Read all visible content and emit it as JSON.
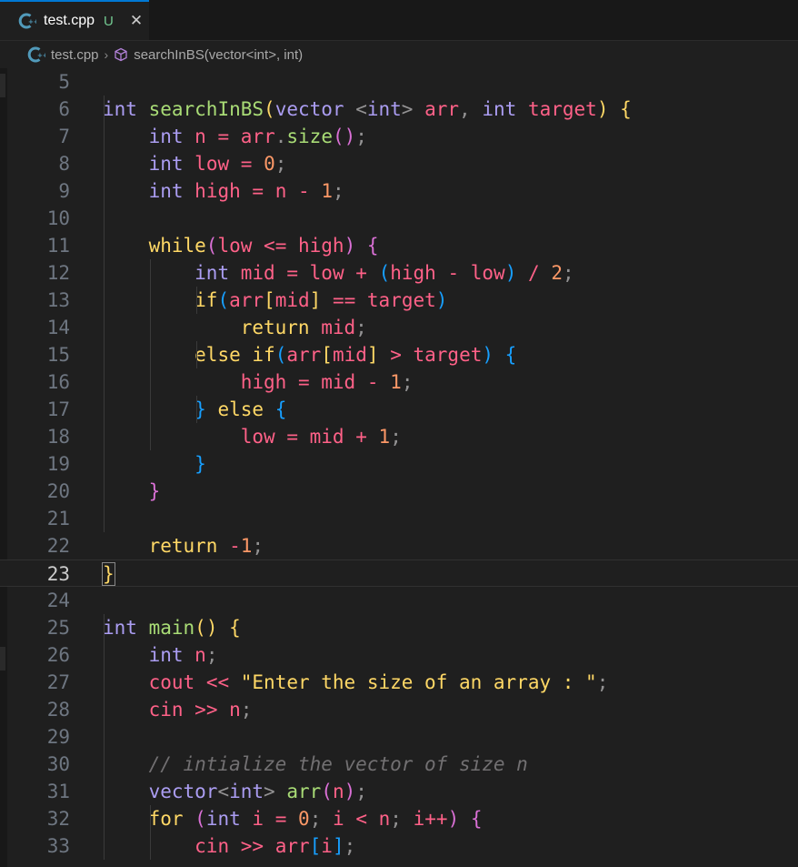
{
  "tab": {
    "filename": "test.cpp",
    "status": "U",
    "close": "✕"
  },
  "breadcrumb": {
    "file": "test.cpp",
    "separator": "›",
    "symbol": "searchInBS(vector<int>, int)"
  },
  "icons": {
    "cpp": "cpp-file-icon",
    "symbol": "cube-symbol-icon",
    "close": "close-icon"
  },
  "colors": {
    "background": "#1f1f1f",
    "tab_accent": "#0078d4",
    "keyword": "#ab9df2",
    "function": "#a9dc76",
    "variable": "#ff6188",
    "number": "#fc9867",
    "string": "#ffd866",
    "comment": "#727072",
    "untracked": "#73c991"
  },
  "editor": {
    "current_line": 23,
    "lines": [
      {
        "n": "5",
        "tokens": []
      },
      {
        "n": "6",
        "tokens": [
          [
            "kw",
            "int"
          ],
          [
            "pl",
            " "
          ],
          [
            "fn",
            "searchInBS"
          ],
          [
            "b1",
            "("
          ],
          [
            "kw",
            "vector"
          ],
          [
            "pl",
            " "
          ],
          [
            "punc",
            "<"
          ],
          [
            "kw",
            "int"
          ],
          [
            "punc",
            ">"
          ],
          [
            "pl",
            " "
          ],
          [
            "var",
            "arr"
          ],
          [
            "punc",
            ","
          ],
          [
            "pl",
            " "
          ],
          [
            "kw",
            "int"
          ],
          [
            "pl",
            " "
          ],
          [
            "var",
            "target"
          ],
          [
            "b1",
            ")"
          ],
          [
            "pl",
            " "
          ],
          [
            "b1",
            "{"
          ]
        ]
      },
      {
        "n": "7",
        "tokens": [
          [
            "pl",
            "    "
          ],
          [
            "kw",
            "int"
          ],
          [
            "pl",
            " "
          ],
          [
            "var",
            "n"
          ],
          [
            "pl",
            " "
          ],
          [
            "op",
            "="
          ],
          [
            "pl",
            " "
          ],
          [
            "var",
            "arr"
          ],
          [
            "punc",
            "."
          ],
          [
            "fn",
            "size"
          ],
          [
            "b2",
            "()"
          ],
          [
            "punc",
            ";"
          ]
        ]
      },
      {
        "n": "8",
        "tokens": [
          [
            "pl",
            "    "
          ],
          [
            "kw",
            "int"
          ],
          [
            "pl",
            " "
          ],
          [
            "var",
            "low"
          ],
          [
            "pl",
            " "
          ],
          [
            "op",
            "="
          ],
          [
            "pl",
            " "
          ],
          [
            "num",
            "0"
          ],
          [
            "punc",
            ";"
          ]
        ]
      },
      {
        "n": "9",
        "tokens": [
          [
            "pl",
            "    "
          ],
          [
            "kw",
            "int"
          ],
          [
            "pl",
            " "
          ],
          [
            "var",
            "high"
          ],
          [
            "pl",
            " "
          ],
          [
            "op",
            "="
          ],
          [
            "pl",
            " "
          ],
          [
            "var",
            "n"
          ],
          [
            "pl",
            " "
          ],
          [
            "op",
            "-"
          ],
          [
            "pl",
            " "
          ],
          [
            "num",
            "1"
          ],
          [
            "punc",
            ";"
          ]
        ]
      },
      {
        "n": "10",
        "tokens": []
      },
      {
        "n": "11",
        "tokens": [
          [
            "pl",
            "    "
          ],
          [
            "ctl",
            "while"
          ],
          [
            "b2",
            "("
          ],
          [
            "var",
            "low"
          ],
          [
            "pl",
            " "
          ],
          [
            "op",
            "<="
          ],
          [
            "pl",
            " "
          ],
          [
            "var",
            "high"
          ],
          [
            "b2",
            ")"
          ],
          [
            "pl",
            " "
          ],
          [
            "b2",
            "{"
          ]
        ]
      },
      {
        "n": "12",
        "tokens": [
          [
            "pl",
            "        "
          ],
          [
            "kw",
            "int"
          ],
          [
            "pl",
            " "
          ],
          [
            "var",
            "mid"
          ],
          [
            "pl",
            " "
          ],
          [
            "op",
            "="
          ],
          [
            "pl",
            " "
          ],
          [
            "var",
            "low"
          ],
          [
            "pl",
            " "
          ],
          [
            "op",
            "+"
          ],
          [
            "pl",
            " "
          ],
          [
            "b3",
            "("
          ],
          [
            "var",
            "high"
          ],
          [
            "pl",
            " "
          ],
          [
            "op",
            "-"
          ],
          [
            "pl",
            " "
          ],
          [
            "var",
            "low"
          ],
          [
            "b3",
            ")"
          ],
          [
            "pl",
            " "
          ],
          [
            "op",
            "/"
          ],
          [
            "pl",
            " "
          ],
          [
            "num",
            "2"
          ],
          [
            "punc",
            ";"
          ]
        ]
      },
      {
        "n": "13",
        "tokens": [
          [
            "pl",
            "        "
          ],
          [
            "ctl",
            "if"
          ],
          [
            "b3",
            "("
          ],
          [
            "var",
            "arr"
          ],
          [
            "b1",
            "["
          ],
          [
            "var",
            "mid"
          ],
          [
            "b1",
            "]"
          ],
          [
            "pl",
            " "
          ],
          [
            "op",
            "=="
          ],
          [
            "pl",
            " "
          ],
          [
            "var",
            "target"
          ],
          [
            "b3",
            ")"
          ]
        ]
      },
      {
        "n": "14",
        "tokens": [
          [
            "pl",
            "            "
          ],
          [
            "ctl",
            "return"
          ],
          [
            "pl",
            " "
          ],
          [
            "var",
            "mid"
          ],
          [
            "punc",
            ";"
          ]
        ]
      },
      {
        "n": "15",
        "tokens": [
          [
            "pl",
            "        "
          ],
          [
            "ctl",
            "else"
          ],
          [
            "pl",
            " "
          ],
          [
            "ctl",
            "if"
          ],
          [
            "b3",
            "("
          ],
          [
            "var",
            "arr"
          ],
          [
            "b1",
            "["
          ],
          [
            "var",
            "mid"
          ],
          [
            "b1",
            "]"
          ],
          [
            "pl",
            " "
          ],
          [
            "op",
            ">"
          ],
          [
            "pl",
            " "
          ],
          [
            "var",
            "target"
          ],
          [
            "b3",
            ")"
          ],
          [
            "pl",
            " "
          ],
          [
            "b3",
            "{"
          ]
        ]
      },
      {
        "n": "16",
        "tokens": [
          [
            "pl",
            "            "
          ],
          [
            "var",
            "high"
          ],
          [
            "pl",
            " "
          ],
          [
            "op",
            "="
          ],
          [
            "pl",
            " "
          ],
          [
            "var",
            "mid"
          ],
          [
            "pl",
            " "
          ],
          [
            "op",
            "-"
          ],
          [
            "pl",
            " "
          ],
          [
            "num",
            "1"
          ],
          [
            "punc",
            ";"
          ]
        ]
      },
      {
        "n": "17",
        "tokens": [
          [
            "pl",
            "        "
          ],
          [
            "b3",
            "}"
          ],
          [
            "pl",
            " "
          ],
          [
            "ctl",
            "else"
          ],
          [
            "pl",
            " "
          ],
          [
            "b3",
            "{"
          ]
        ]
      },
      {
        "n": "18",
        "tokens": [
          [
            "pl",
            "            "
          ],
          [
            "var",
            "low"
          ],
          [
            "pl",
            " "
          ],
          [
            "op",
            "="
          ],
          [
            "pl",
            " "
          ],
          [
            "var",
            "mid"
          ],
          [
            "pl",
            " "
          ],
          [
            "op",
            "+"
          ],
          [
            "pl",
            " "
          ],
          [
            "num",
            "1"
          ],
          [
            "punc",
            ";"
          ]
        ]
      },
      {
        "n": "19",
        "tokens": [
          [
            "pl",
            "        "
          ],
          [
            "b3",
            "}"
          ]
        ]
      },
      {
        "n": "20",
        "tokens": [
          [
            "pl",
            "    "
          ],
          [
            "b2",
            "}"
          ]
        ]
      },
      {
        "n": "21",
        "tokens": []
      },
      {
        "n": "22",
        "tokens": [
          [
            "pl",
            "    "
          ],
          [
            "ctl",
            "return"
          ],
          [
            "pl",
            " "
          ],
          [
            "op",
            "-"
          ],
          [
            "num",
            "1"
          ],
          [
            "punc",
            ";"
          ]
        ]
      },
      {
        "n": "23",
        "tokens": [
          [
            "b1cur",
            "}"
          ]
        ]
      },
      {
        "n": "24",
        "tokens": []
      },
      {
        "n": "25",
        "tokens": [
          [
            "kw",
            "int"
          ],
          [
            "pl",
            " "
          ],
          [
            "fn",
            "main"
          ],
          [
            "b1",
            "()"
          ],
          [
            "pl",
            " "
          ],
          [
            "b1",
            "{"
          ]
        ]
      },
      {
        "n": "26",
        "tokens": [
          [
            "pl",
            "    "
          ],
          [
            "kw",
            "int"
          ],
          [
            "pl",
            " "
          ],
          [
            "var",
            "n"
          ],
          [
            "punc",
            ";"
          ]
        ]
      },
      {
        "n": "27",
        "tokens": [
          [
            "pl",
            "    "
          ],
          [
            "var",
            "cout"
          ],
          [
            "pl",
            " "
          ],
          [
            "op",
            "<<"
          ],
          [
            "pl",
            " "
          ],
          [
            "str",
            "\"Enter the size of an array : \""
          ],
          [
            "punc",
            ";"
          ]
        ]
      },
      {
        "n": "28",
        "tokens": [
          [
            "pl",
            "    "
          ],
          [
            "var",
            "cin"
          ],
          [
            "pl",
            " "
          ],
          [
            "op",
            ">>"
          ],
          [
            "pl",
            " "
          ],
          [
            "var",
            "n"
          ],
          [
            "punc",
            ";"
          ]
        ]
      },
      {
        "n": "29",
        "tokens": []
      },
      {
        "n": "30",
        "tokens": [
          [
            "pl",
            "    "
          ],
          [
            "cm",
            "// intialize the vector of size n"
          ]
        ]
      },
      {
        "n": "31",
        "tokens": [
          [
            "pl",
            "    "
          ],
          [
            "kw",
            "vector"
          ],
          [
            "punc",
            "<"
          ],
          [
            "kw",
            "int"
          ],
          [
            "punc",
            ">"
          ],
          [
            "pl",
            " "
          ],
          [
            "fn",
            "arr"
          ],
          [
            "b2",
            "("
          ],
          [
            "var",
            "n"
          ],
          [
            "b2",
            ")"
          ],
          [
            "punc",
            ";"
          ]
        ]
      },
      {
        "n": "32",
        "tokens": [
          [
            "pl",
            "    "
          ],
          [
            "ctl",
            "for"
          ],
          [
            "pl",
            " "
          ],
          [
            "b2",
            "("
          ],
          [
            "kw",
            "int"
          ],
          [
            "pl",
            " "
          ],
          [
            "var",
            "i"
          ],
          [
            "pl",
            " "
          ],
          [
            "op",
            "="
          ],
          [
            "pl",
            " "
          ],
          [
            "num",
            "0"
          ],
          [
            "punc",
            ";"
          ],
          [
            "pl",
            " "
          ],
          [
            "var",
            "i"
          ],
          [
            "pl",
            " "
          ],
          [
            "op",
            "<"
          ],
          [
            "pl",
            " "
          ],
          [
            "var",
            "n"
          ],
          [
            "punc",
            ";"
          ],
          [
            "pl",
            " "
          ],
          [
            "var",
            "i"
          ],
          [
            "op",
            "++"
          ],
          [
            "b2",
            ")"
          ],
          [
            "pl",
            " "
          ],
          [
            "b2",
            "{"
          ]
        ]
      },
      {
        "n": "33",
        "tokens": [
          [
            "pl",
            "        "
          ],
          [
            "var",
            "cin"
          ],
          [
            "pl",
            " "
          ],
          [
            "op",
            ">>"
          ],
          [
            "pl",
            " "
          ],
          [
            "var",
            "arr"
          ],
          [
            "b3",
            "["
          ],
          [
            "var",
            "i"
          ],
          [
            "b3",
            "]"
          ],
          [
            "punc",
            ";"
          ]
        ]
      }
    ]
  }
}
